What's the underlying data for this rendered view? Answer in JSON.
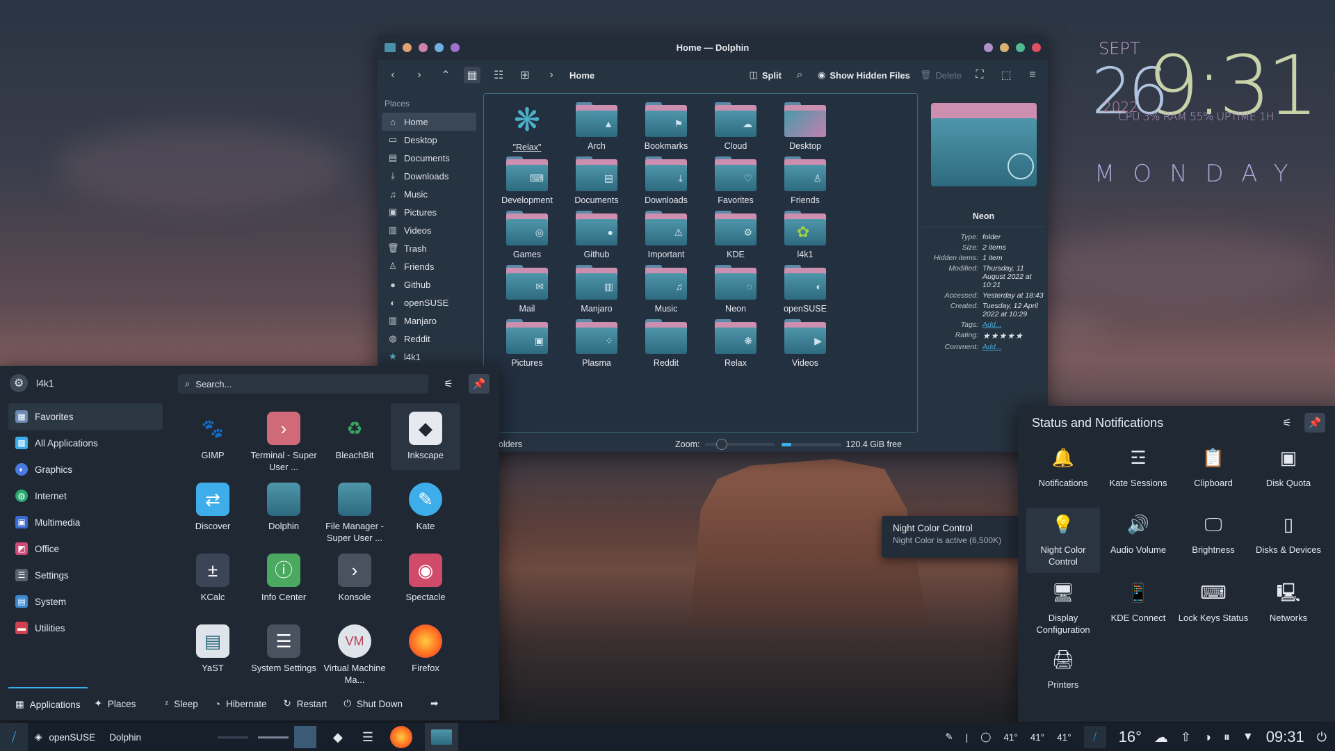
{
  "clock": {
    "month": "SEPT",
    "day": "26",
    "time": "9:31",
    "year": "2022",
    "stats": "CPU 3% RAM 55% UPTIME 1H",
    "weekday": "MONDAY"
  },
  "dolphin": {
    "title": "Home — Dolphin",
    "breadcrumb": "Home",
    "split_label": "Split",
    "hidden_label": "Show Hidden Files",
    "delete_label": "Delete",
    "places_header": "Places",
    "places": [
      "Home",
      "Desktop",
      "Documents",
      "Downloads",
      "Music",
      "Pictures",
      "Videos",
      "Trash",
      "Friends",
      "Github",
      "openSUSE",
      "Manjaro",
      "Reddit",
      "l4k1"
    ],
    "folders": [
      "\"Relax\"",
      "Arch",
      "Bookmarks",
      "Cloud",
      "Desktop",
      "Development",
      "Documents",
      "Downloads",
      "Favorites",
      "Friends",
      "Games",
      "Github",
      "Important",
      "KDE",
      "l4k1",
      "Mail",
      "Manjaro",
      "Music",
      "Neon",
      "openSUSE",
      "Pictures",
      "Plasma",
      "Reddit",
      "Relax",
      "Videos"
    ],
    "status_left": "olders",
    "zoom_label": "Zoom:",
    "free_space": "120.4 GiB free",
    "info": {
      "name": "Neon",
      "type_k": "Type:",
      "type": "folder",
      "size_k": "Size:",
      "size": "2 items",
      "hidden_k": "Hidden items:",
      "hidden": "1 item",
      "modified_k": "Modified:",
      "modified": "Thursday, 11 August 2022 at 10:21",
      "accessed_k": "Accessed:",
      "accessed": "Yesterday at 18:43",
      "created_k": "Created:",
      "created": "Tuesday, 12 April 2022 at 10:29",
      "tags_k": "Tags:",
      "tags": "Add...",
      "rating_k": "Rating:",
      "rating": "★★★★★",
      "comment_k": "Comment:",
      "comment": "Add..."
    }
  },
  "launcher": {
    "user": "l4k1",
    "search_placeholder": "Search...",
    "categories": [
      "Favorites",
      "All Applications",
      "Graphics",
      "Internet",
      "Multimedia",
      "Office",
      "Settings",
      "System",
      "Utilities"
    ],
    "apps": [
      {
        "name": "GIMP"
      },
      {
        "name": "Terminal - Super User ..."
      },
      {
        "name": "BleachBit"
      },
      {
        "name": "Inkscape"
      },
      {
        "name": "Discover"
      },
      {
        "name": "Dolphin"
      },
      {
        "name": "File Manager - Super User ..."
      },
      {
        "name": "Kate"
      },
      {
        "name": "KCalc"
      },
      {
        "name": "Info Center"
      },
      {
        "name": "Konsole"
      },
      {
        "name": "Spectacle"
      },
      {
        "name": "YaST"
      },
      {
        "name": "System Settings"
      },
      {
        "name": "Virtual Machine Ma..."
      },
      {
        "name": "Firefox"
      }
    ],
    "tab_apps": "Applications",
    "tab_places": "Places",
    "sleep": "Sleep",
    "hibernate": "Hibernate",
    "restart": "Restart",
    "shutdown": "Shut Down"
  },
  "status": {
    "title": "Status and Notifications",
    "tiles": [
      "Notifications",
      "Kate Sessions",
      "Clipboard",
      "Disk Quota",
      "Night Color Control",
      "Audio Volume",
      "Brightness",
      "Disks & Devices",
      "Display Configuration",
      "KDE Connect",
      "Lock Keys Status",
      "Networks",
      "Printers"
    ],
    "tooltip_title": "Night Color Control",
    "tooltip_text": "Night Color is active (6,500K)"
  },
  "taskbar": {
    "app1": "openSUSE",
    "app2": "Dolphin",
    "temp1": "41°",
    "temp2": "41°",
    "temp3": "41°",
    "weather": "16°",
    "time": "09:31"
  }
}
